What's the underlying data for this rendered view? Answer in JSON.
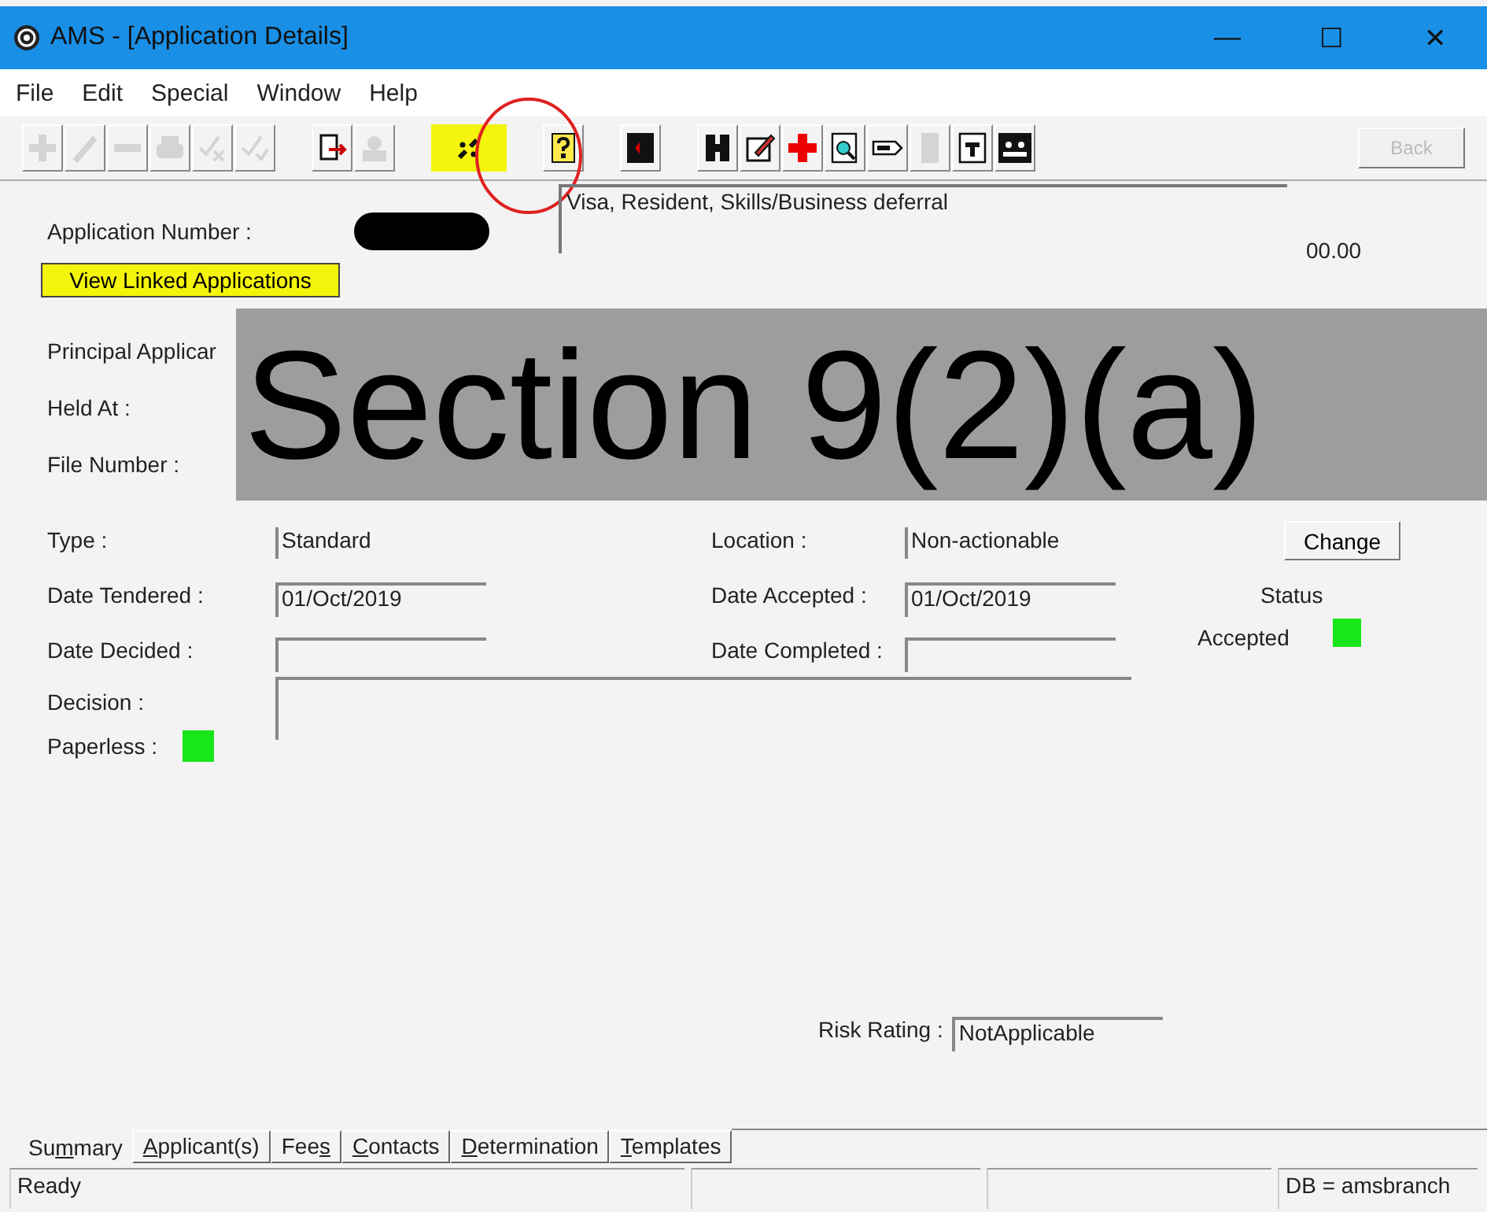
{
  "window": {
    "title": "AMS - [Application Details]",
    "controls": [
      "—",
      "☐",
      "✕"
    ]
  },
  "menu": [
    "File",
    "Edit",
    "Special",
    "Window",
    "Help"
  ],
  "toolbar": [
    {
      "kind": "plus",
      "disabled": true
    },
    {
      "kind": "pencil",
      "disabled": true
    },
    {
      "kind": "minus",
      "disabled": true
    },
    {
      "kind": "printer",
      "disabled": true
    },
    {
      "kind": "checkx",
      "disabled": true
    },
    {
      "kind": "check",
      "disabled": true
    },
    {
      "kind": "gap"
    },
    {
      "kind": "docarrow",
      "disabled": false
    },
    {
      "kind": "stamp",
      "disabled": true
    },
    {
      "kind": "gap"
    },
    {
      "kind": "link",
      "disabled": false,
      "highlighted": true
    },
    {
      "kind": "gap"
    },
    {
      "kind": "question",
      "disabled": false
    },
    {
      "kind": "gap"
    },
    {
      "kind": "book",
      "disabled": false
    },
    {
      "kind": "gap"
    },
    {
      "kind": "h",
      "disabled": false
    },
    {
      "kind": "editdoc",
      "disabled": false
    },
    {
      "kind": "cross",
      "disabled": false
    },
    {
      "kind": "search",
      "disabled": false
    },
    {
      "kind": "tag",
      "disabled": false
    },
    {
      "kind": "bar",
      "disabled": true
    },
    {
      "kind": "textdoc",
      "disabled": false
    },
    {
      "kind": "people",
      "disabled": false
    }
  ],
  "back_button": {
    "label": "Back",
    "disabled": true
  },
  "header": {
    "application_number_label": "Application Number :",
    "description": "Visa, Resident, Skills/Business deferral",
    "amount": "00.00",
    "linked_button": "View Linked Applications"
  },
  "hidden_labels": [
    "Principal Applicar",
    "Held At :",
    "File Number :"
  ],
  "redaction": {
    "label": "Section 9(2)(a)"
  },
  "fields": {
    "type": {
      "label": "Type :",
      "value": "Standard"
    },
    "location": {
      "label": "Location :",
      "value": "Non-actionable"
    },
    "change_button": "Change",
    "date_tendered": {
      "label": "Date Tendered :",
      "value": "01/Oct/2019"
    },
    "date_accepted": {
      "label": "Date Accepted :",
      "value": "01/Oct/2019"
    },
    "status": {
      "label": "Status",
      "value": "Accepted",
      "color": "#19e619"
    },
    "date_decided": {
      "label": "Date Decided :"
    },
    "date_completed": {
      "label": "Date Completed :"
    },
    "decision": {
      "label": "Decision :"
    },
    "paperless": {
      "label": "Paperless :",
      "color": "#19e619"
    },
    "risk_rating": {
      "label": "Risk Rating :",
      "value": "NotApplicable"
    }
  },
  "tabs": [
    {
      "pre": "Su",
      "key": "m",
      "post": "mary",
      "selected": true
    },
    {
      "key": "A",
      "post": "pplicant(s)",
      "selected": false
    },
    {
      "pre": "Fee",
      "key": "s",
      "selected": false
    },
    {
      "key": "C",
      "post": "ontacts",
      "selected": false
    },
    {
      "key": "D",
      "post": "etermination",
      "selected": false
    },
    {
      "key": "T",
      "post": "emplates",
      "selected": false
    }
  ],
  "status_bar": {
    "left": "Ready",
    "right": "DB = amsbranch"
  }
}
